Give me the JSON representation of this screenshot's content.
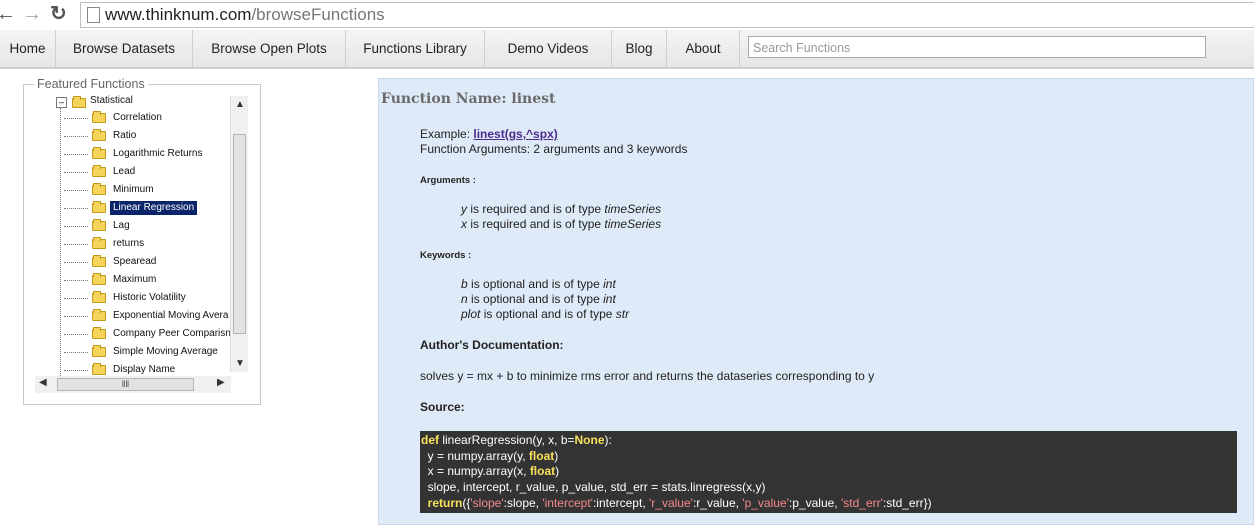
{
  "browser": {
    "url_domain": "www.thinknum.com",
    "url_path": "/browseFunctions"
  },
  "nav": {
    "items": [
      "Home",
      "Browse Datasets",
      "Browse Open Plots",
      "Functions Library",
      "Demo Videos",
      "Blog",
      "About"
    ],
    "search_placeholder": "Search Functions"
  },
  "sidebar": {
    "title": "Featured Functions",
    "root_label": "Statistical",
    "items": [
      "Correlation",
      "Ratio",
      "Logarithmic Returns",
      "Lead",
      "Minimum",
      "Linear Regression",
      "Lag",
      "returns",
      "Spearead",
      "Maximum",
      "Historic Volatility",
      "Exponential Moving Avera",
      "Company Peer Comparisn",
      "Simple Moving Average",
      "Display Name"
    ],
    "selected_item": "Linear Regression"
  },
  "function": {
    "name_label": "Function Name: linest",
    "example_label": "Example:",
    "example_link": "linest(gs,^spx)",
    "arguments_summary": "Function Arguments: 2 arguments and 3 keywords",
    "arguments_heading": "Arguments :",
    "arguments": [
      {
        "name": "y",
        "text": " is required and is of type ",
        "type": "timeSeries"
      },
      {
        "name": "x",
        "text": " is required and is of type ",
        "type": "timeSeries"
      }
    ],
    "keywords_heading": "Keywords :",
    "keywords": [
      {
        "name": "b",
        "text": " is optional and is of type ",
        "type": "int"
      },
      {
        "name": "n",
        "text": " is optional and is of type ",
        "type": "int"
      },
      {
        "name": "plot",
        "text": " is optional and is of type ",
        "type": "str"
      }
    ],
    "author_doc_heading": "Author's Documentation:",
    "author_doc": "solves y = mx + b to minimize rms error and returns the dataseries corresponding to y",
    "source_heading": "Source:"
  },
  "code": {
    "line1_def": "def",
    "line1_rest": " linearRegression(y, x, b=",
    "line1_none": "None",
    "line1_end": "):",
    "line2_a": "  y = numpy.array(y, ",
    "line2_kw": "float",
    "line2_b": ")",
    "line3_a": "  x = numpy.array(x, ",
    "line3_kw": "float",
    "line3_b": ")",
    "line4": "  slope, intercept, r_value, p_value, std_err = stats.linregress(x,y)",
    "line5_ret": "  return",
    "line5_p1": "({",
    "s1": "'slope'",
    "v1": ":slope, ",
    "s2": "'intercept'",
    "v2": ":intercept, ",
    "s3": "'r_value'",
    "v3": ":r_value, ",
    "s4": "'p_value'",
    "v4": ":p_value, ",
    "s5": "'std_err'",
    "v5": ":std_err})"
  },
  "colors": {
    "content_bg": "#dfeaf8",
    "code_bg": "#333333",
    "keyword": "#f7e15b",
    "string": "#f58a8a",
    "selected": "#0a246a"
  }
}
